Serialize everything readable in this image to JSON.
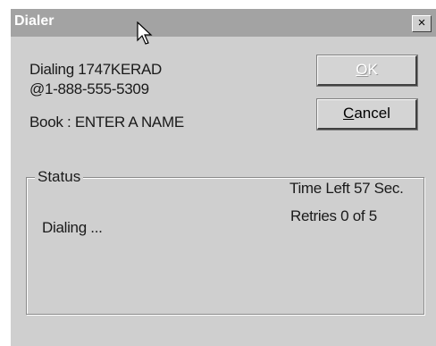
{
  "window": {
    "title": "Dialer",
    "close_label": "×"
  },
  "dialing": {
    "line1": "Dialing 1747KERAD",
    "line2": "@1-888-555-5309",
    "book": "Book : ENTER A NAME"
  },
  "buttons": {
    "ok_prefix": "",
    "ok_underline": "O",
    "ok_rest": "K",
    "cancel_underline": "C",
    "cancel_rest": "ancel"
  },
  "status": {
    "label": "Status",
    "time_left": "Time Left 57 Sec.",
    "retries": "Retries 0   of  5",
    "state": "Dialing ..."
  }
}
